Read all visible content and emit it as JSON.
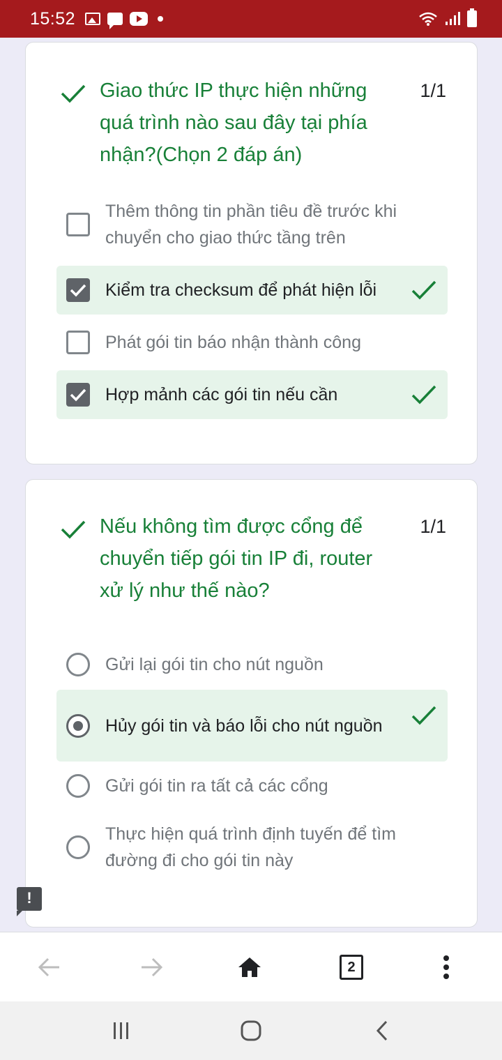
{
  "status_bar": {
    "time": "15:52",
    "left_icons": [
      "gallery-icon",
      "chat-icon",
      "youtube-icon",
      "dot-icon"
    ],
    "right_icons": [
      "wifi-icon",
      "signal-icon",
      "battery-icon"
    ]
  },
  "questions": [
    {
      "title": "Giao thức IP thực hiện những quá trình nào sau đây tại phía nhận?(Chọn 2 đáp án)",
      "score": "1/1",
      "type": "checkbox",
      "options": [
        {
          "label": "Thêm thông tin phần tiêu đề trước khi chuyển cho giao thức tầng trên",
          "checked": false,
          "correct": false
        },
        {
          "label": "Kiểm tra checksum để phát hiện lỗi",
          "checked": true,
          "correct": true
        },
        {
          "label": "Phát gói tin báo nhận thành công",
          "checked": false,
          "correct": false
        },
        {
          "label": "Hợp mảnh các gói tin nếu cần",
          "checked": true,
          "correct": true
        }
      ]
    },
    {
      "title": "Nếu không tìm được cổng để chuyển tiếp gói tin IP đi, router xử lý như thế nào?",
      "score": "1/1",
      "type": "radio",
      "options": [
        {
          "label": "Gửi lại gói tin cho nút nguồn",
          "checked": false,
          "correct": false
        },
        {
          "label": "Hủy gói tin và báo lỗi cho nút nguồn",
          "checked": true,
          "correct": true
        },
        {
          "label": "Gửi gói tin ra tất cả các cổng",
          "checked": false,
          "correct": false
        },
        {
          "label": "Thực hiện quá trình định tuyến để tìm đường đi cho gói tin này",
          "checked": false,
          "correct": false
        }
      ]
    }
  ],
  "feedback_flag": "!",
  "browser_toolbar": {
    "tab_count": "2",
    "icons": [
      "back-arrow-icon",
      "forward-arrow-icon",
      "home-icon",
      "tab-switcher-icon",
      "more-menu-icon"
    ]
  },
  "colors": {
    "status_bar": "#a51a1d",
    "correct_green": "#188038",
    "correct_bg": "#e6f4ea",
    "page_bg": "#ecebf7"
  }
}
